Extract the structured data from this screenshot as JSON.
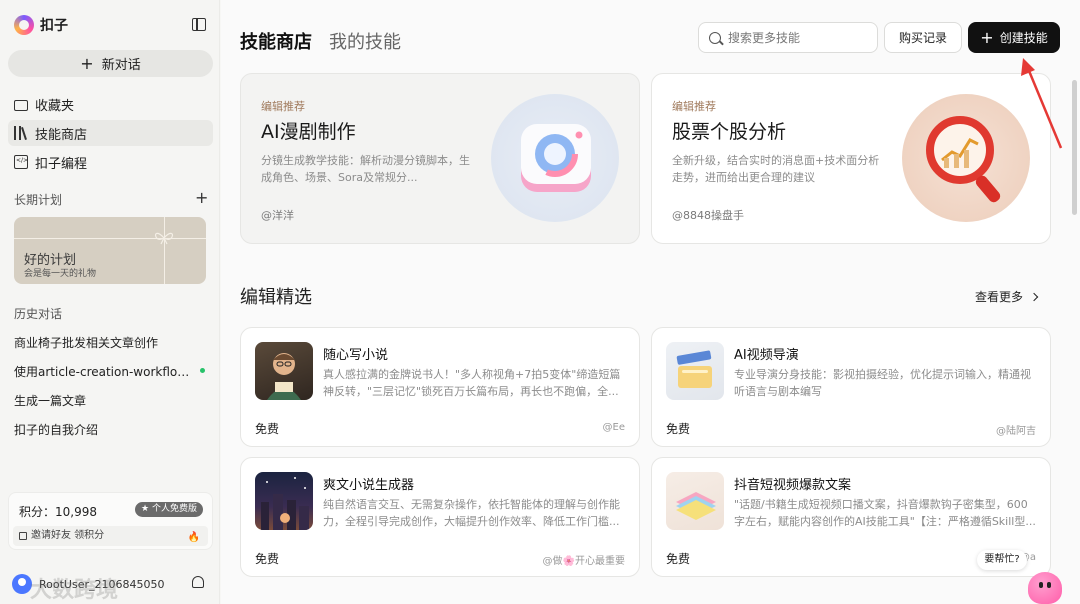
{
  "app": {
    "name": "扣子"
  },
  "sidebar": {
    "new_chat": "新对话",
    "nav": [
      {
        "label": "收藏夹",
        "icon": "folder-icon"
      },
      {
        "label": "技能商店",
        "icon": "books-icon",
        "active": true
      },
      {
        "label": "扣子编程",
        "icon": "code-icon"
      }
    ],
    "long_term_plan": {
      "label": "长期计划",
      "card_title": "好的计划",
      "card_subtitle": "会是每一天的礼物"
    },
    "history": {
      "label": "历史对话",
      "items": [
        "商业椅子批发相关文章创作",
        "使用article-creation-workflow生...",
        "生成一篇文章",
        "扣子的自我介绍"
      ]
    },
    "credits": {
      "label": "积分：10,998",
      "badge": "个人免费版",
      "invite": "邀请好友 领积分"
    },
    "user": {
      "name": "RootUser_2106845050"
    }
  },
  "header": {
    "tabs": [
      "技能商店",
      "我的技能"
    ],
    "search_placeholder": "搜索更多技能",
    "purchase_history": "购买记录",
    "create_skill": "创建技能"
  },
  "featured": [
    {
      "tag": "编辑推荐",
      "title": "AI漫剧制作",
      "desc": "分镜生成教学技能：解析动漫分镜脚本，生成角色、场景、Sora及常规分...",
      "author": "@洋洋"
    },
    {
      "tag": "编辑推荐",
      "title": "股票个股分析",
      "desc": "全新升级，结合实时的消息面+技术面分析走势，进而给出更合理的建议",
      "author": "@8848操盘手"
    }
  ],
  "editors_picks": {
    "title": "编辑精选",
    "see_more": "查看更多",
    "items": [
      {
        "name": "随心写小说",
        "desc": "真人感拉满的金牌说书人！\"多人称视角+7拍5变体\"缔造短篇神反转，\"三层记忆\"锁死百万长篇布局，再长也不跑偏，全...",
        "price": "免费",
        "author": "@Ee"
      },
      {
        "name": "AI视频导演",
        "desc": "专业导演分身技能：影视拍摄经验，优化提示词输入，精通视听语言与剧本编写",
        "price": "免费",
        "author": "@陆阿吉"
      },
      {
        "name": "爽文小说生成器",
        "desc": "纯自然语言交互、无需复杂操作，依托智能体的理解与创作能力，全程引导完成创作，大幅提升创作效率、降低工作门槛...",
        "price": "免费",
        "author": "@做🌸开心最重要"
      },
      {
        "name": "抖音短视频爆款文案",
        "desc": "\"话题/书籍生成短视频口播文案，抖音爆款钩子密集型，600字左右，赋能内容创作的AI技能工具\"【注：严格遵循Skill型...",
        "price": "免费",
        "author": "@a"
      }
    ]
  },
  "help": {
    "label": "要帮忙?"
  },
  "watermark": "大数跨境",
  "colors": {
    "accent_dark": "#111111",
    "tag": "#a07a5c",
    "online": "#27c26a",
    "arrow": "#e53935"
  }
}
